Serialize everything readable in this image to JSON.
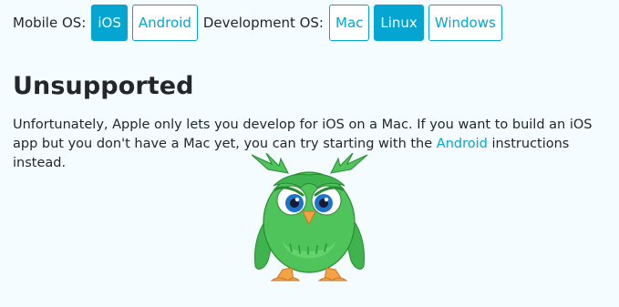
{
  "selector": {
    "mobile_label": "Mobile OS:",
    "mobile_options": [
      {
        "label": "iOS",
        "selected": true
      },
      {
        "label": "Android",
        "selected": false
      }
    ],
    "dev_label": "Development OS:",
    "dev_options": [
      {
        "label": "Mac",
        "selected": false
      },
      {
        "label": "Linux",
        "selected": true
      },
      {
        "label": "Windows",
        "selected": false
      }
    ]
  },
  "heading": "Unsupported",
  "paragraph": {
    "before": "Unfortunately, Apple only lets you develop for iOS on a Mac. If you want to build an iOS app but you don't have a Mac yet, you can try starting with the ",
    "link": "Android",
    "after": " instructions instead."
  },
  "illustration": {
    "icon": "sad-owl-illustration"
  },
  "colors": {
    "accent": "#05a5d1",
    "background": "#f5fcff",
    "text": "#242729",
    "owl_green": "#4ec45a"
  }
}
